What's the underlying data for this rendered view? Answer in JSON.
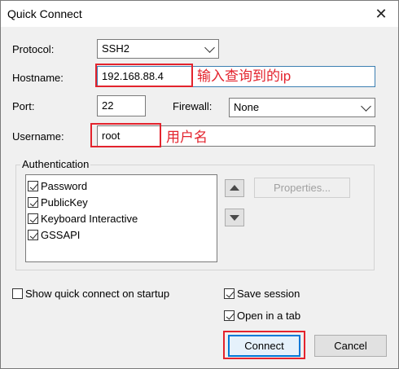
{
  "window": {
    "title": "Quick Connect"
  },
  "form": {
    "protocol_label": "Protocol:",
    "protocol_value": "SSH2",
    "hostname_label": "Hostname:",
    "hostname_value": "192.168.88.4",
    "port_label": "Port:",
    "port_value": "22",
    "firewall_label": "Firewall:",
    "firewall_value": "None",
    "username_label": "Username:",
    "username_value": "root"
  },
  "annotations": {
    "hostname_note": "输入查询到的ip",
    "username_note": "用户名"
  },
  "authentication": {
    "title": "Authentication",
    "methods": [
      {
        "label": "Password",
        "checked": true
      },
      {
        "label": "PublicKey",
        "checked": true
      },
      {
        "label": "Keyboard Interactive",
        "checked": true
      },
      {
        "label": "GSSAPI",
        "checked": true
      }
    ],
    "properties_label": "Properties..."
  },
  "options": {
    "show_on_startup_label": "Show quick connect on startup",
    "show_on_startup_checked": false,
    "save_session_label": "Save session",
    "save_session_checked": true,
    "open_in_tab_label": "Open in a tab",
    "open_in_tab_checked": true
  },
  "buttons": {
    "connect": "Connect",
    "cancel": "Cancel"
  },
  "colors": {
    "annotation_red": "#e3232d",
    "focus_blue": "#0078d7"
  }
}
